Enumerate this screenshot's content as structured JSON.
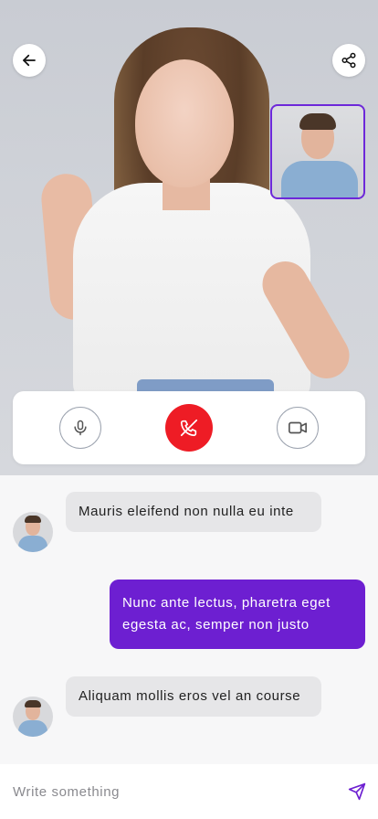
{
  "call": {
    "back_icon": "arrow-left-icon",
    "share_icon": "share-icon",
    "controls": {
      "mic_icon": "microphone-icon",
      "end_icon": "phone-hangup-icon",
      "camera_icon": "video-camera-icon",
      "end_color": "#ee1c25"
    }
  },
  "chat": {
    "messages": [
      {
        "direction": "incoming",
        "text": "Mauris eleifend non nulla eu inte"
      },
      {
        "direction": "outgoing",
        "text": "Nunc ante lectus, pharetra eget egesta ac, semper non justo"
      },
      {
        "direction": "incoming",
        "text": "Aliquam mollis eros vel an course"
      }
    ],
    "outgoing_color": "#6d1fd1",
    "incoming_color": "#e6e6e8"
  },
  "composer": {
    "placeholder": "Write something",
    "send_icon": "send-icon"
  }
}
